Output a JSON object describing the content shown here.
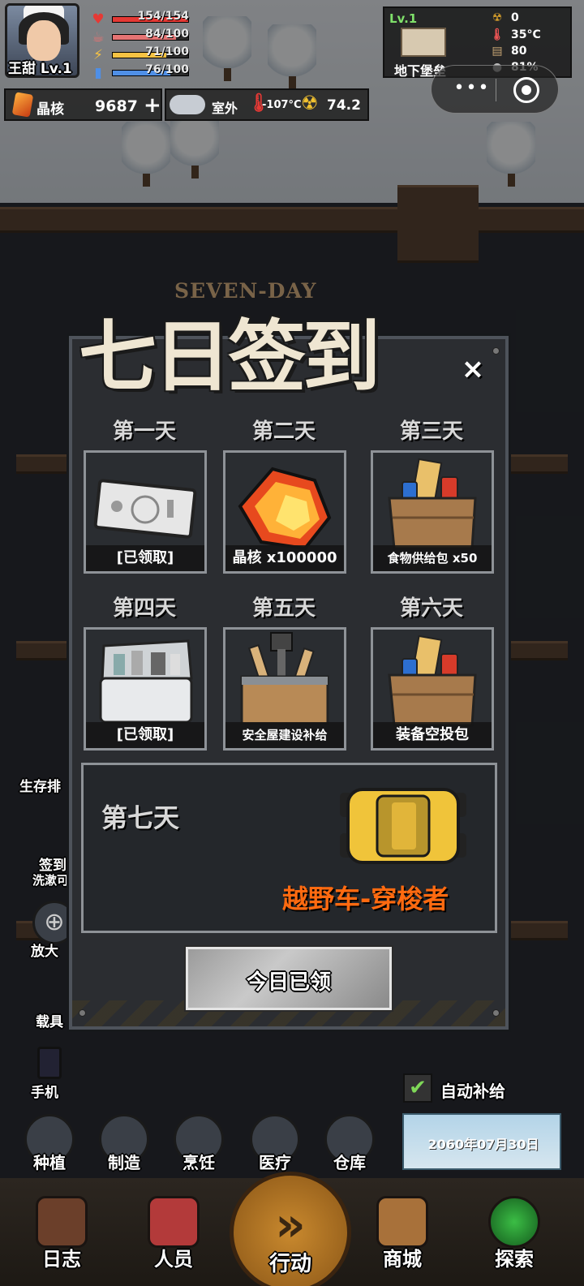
{
  "player": {
    "name": "王甜 Lv.1"
  },
  "stats": [
    {
      "icon": "heart-icon",
      "glyph": "♥",
      "value": "154/154",
      "color": "#e53935",
      "fill": 1.0
    },
    {
      "icon": "stomach-icon",
      "glyph": "☕",
      "value": "84/100",
      "color": "#e57373",
      "fill": 0.84
    },
    {
      "icon": "energy-icon",
      "glyph": "⚡",
      "value": "71/100",
      "color": "#f6c343",
      "fill": 0.71
    },
    {
      "icon": "water-icon",
      "glyph": "▮",
      "value": "76/100",
      "color": "#4f8fe6",
      "fill": 0.76
    }
  ],
  "resources": {
    "crystal_label": "晶核",
    "crystal_value": "9687",
    "add": "+",
    "weather_label": "室外",
    "temperature": "-107°C",
    "radiation": "74.2"
  },
  "shelter": {
    "level": "Lv.1",
    "name": "地下堡垒",
    "radiation_val": "0",
    "temp_val": "35°C",
    "material_val": "80",
    "humidity_val": "81%"
  },
  "capsule": {
    "more": "•••"
  },
  "side_buttons": {
    "rank": "生存排",
    "checkin": "签到",
    "checkin_sub": "洗漱可",
    "zoom": "放大",
    "carrier": "载具",
    "phone": "手机"
  },
  "categories": [
    "种植",
    "制造",
    "烹饪",
    "医疗",
    "仓库"
  ],
  "auto_supply": {
    "label": "自动补给",
    "check": "✔"
  },
  "date": "2060年07月30日",
  "nav": {
    "log": "日志",
    "staff": "人员",
    "action": "行动",
    "action_glyph": "»",
    "shop": "商城",
    "explore": "探索"
  },
  "modal": {
    "title_en": "SEVEN-DAY",
    "title": "七日签到",
    "close": "×",
    "days": [
      {
        "label": "第一天",
        "reward": "[已领取]"
      },
      {
        "label": "第二天",
        "reward": "晶核 x100000"
      },
      {
        "label": "第三天",
        "reward": "食物供给包 x50"
      },
      {
        "label": "第四天",
        "reward": "[已领取]"
      },
      {
        "label": "第五天",
        "reward": "安全屋建设补给"
      },
      {
        "label": "第六天",
        "reward": "装备空投包"
      }
    ],
    "day7": {
      "label": "第七天",
      "reward": "越野车-穿梭者"
    },
    "claim_button": "今日已领"
  }
}
